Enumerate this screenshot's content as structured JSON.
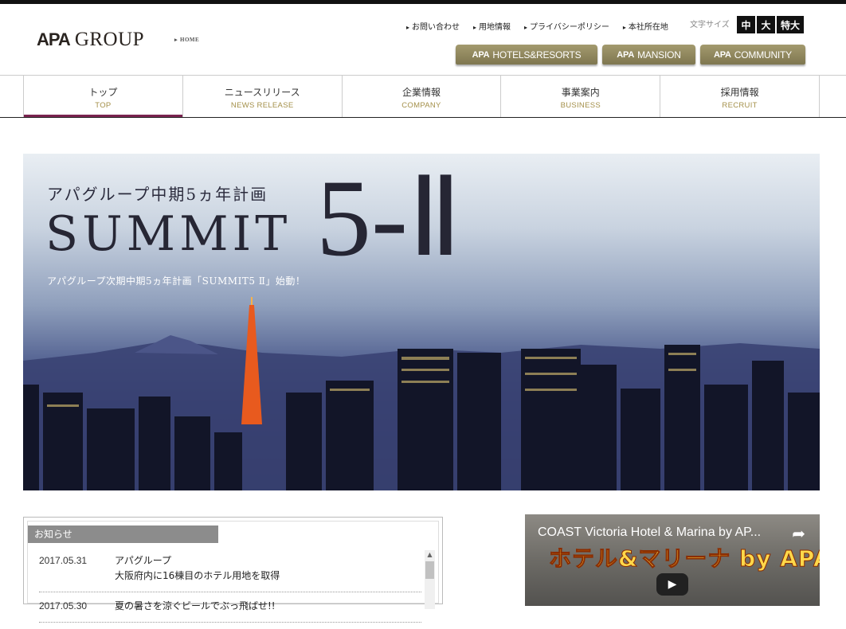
{
  "header": {
    "logo_mark": "APA",
    "logo_text": "GROUP",
    "home_label": "HOME",
    "util_links": [
      "お問い合わせ",
      "用地情報",
      "プライバシーポリシー",
      "本社所在地"
    ],
    "font_size_label": "文字サイズ",
    "font_size_buttons": [
      "中",
      "大",
      "特大"
    ],
    "brands": [
      {
        "mark": "APA",
        "label": "HOTELS&RESORTS"
      },
      {
        "mark": "APA",
        "label": "MANSION"
      },
      {
        "mark": "APA",
        "label": "COMMUNITY"
      }
    ]
  },
  "nav": [
    {
      "jp": "トップ",
      "en": "TOP"
    },
    {
      "jp": "ニュースリリース",
      "en": "NEWS RELEASE"
    },
    {
      "jp": "企業情報",
      "en": "COMPANY"
    },
    {
      "jp": "事業案内",
      "en": "BUSINESS"
    },
    {
      "jp": "採用情報",
      "en": "RECRUIT"
    }
  ],
  "hero": {
    "subtitle": "アパグループ中期5ヵ年計画",
    "title": "SUMMIT",
    "title_num": "5-Ⅱ",
    "tagline": "アパグループ次期中期5ヵ年計画「SUMMIT5 Ⅱ」始動！"
  },
  "notice": {
    "title": "お知らせ",
    "items": [
      {
        "date": "2017.05.31",
        "text": "アパグループ\n大阪府内に16棟目のホテル用地を取得"
      },
      {
        "date": "2017.05.30",
        "text": "夏の暑さを涼ぐビールでぶっ飛ばせ!!"
      }
    ]
  },
  "video": {
    "title": "COAST Victoria Hotel & Marina by AP...",
    "overlay_text": "ホテル&マリーナ by APA",
    "play_icon": "play-icon"
  },
  "colors": {
    "brand_gold": "#8d8460",
    "nav_active": "#7a2450",
    "nav_en": "#a4904a"
  }
}
